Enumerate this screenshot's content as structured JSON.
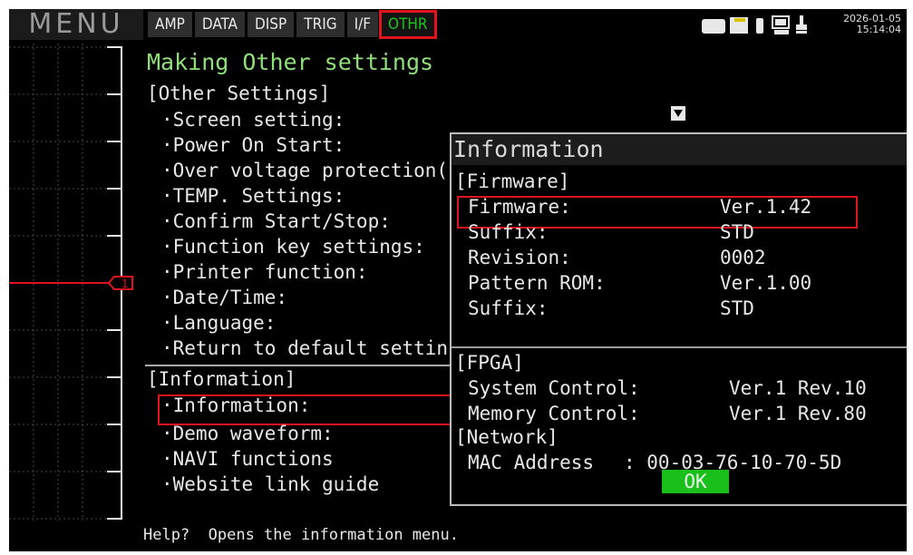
{
  "header": {
    "menu_label": "MENU",
    "tabs": [
      {
        "label": "AMP"
      },
      {
        "label": "DATA"
      },
      {
        "label": "DISP"
      },
      {
        "label": "TRIG"
      },
      {
        "label": "I/F"
      },
      {
        "label": "OTHR",
        "active": true
      }
    ],
    "date": "2026-01-05",
    "time": "15:14:04",
    "status_icons": [
      "memory-card-icon",
      "sd-card-icon",
      "usb-stick-icon",
      "network-pc-icon",
      "plug-icon"
    ]
  },
  "waveform": {
    "channel_marker": "1",
    "trace_color": "#e0141e"
  },
  "menu": {
    "title": "Making Other settings",
    "other_section": "[Other Settings]",
    "other_items": [
      "·Screen setting:",
      "·Power On Start:",
      "·Over voltage protection(",
      "·TEMP. Settings:",
      "·Confirm Start/Stop:",
      "·Function key settings:",
      "·Printer function:",
      "·Date/Time:",
      "·Language:",
      "·Return to default settin"
    ],
    "info_section": "[Information]",
    "info_items": [
      "·Information:",
      "·Demo waveform:",
      "·NAVI functions",
      "·Website link guide"
    ]
  },
  "dialog": {
    "title": "Information",
    "firmware_section": "[Firmware]",
    "firmware_rows": [
      {
        "label": "Firmware:",
        "value": "Ver.1.42"
      },
      {
        "label": "Suffix:",
        "value": "STD"
      },
      {
        "label": "Revision:",
        "value": "0002"
      },
      {
        "label": "Pattern ROM:",
        "value": "Ver.1.00"
      },
      {
        "label": "Suffix:",
        "value": "STD"
      }
    ],
    "fpga_section": "[FPGA]",
    "fpga_rows": [
      {
        "label": "System Control:",
        "value": "Ver.1 Rev.10"
      },
      {
        "label": "Memory Control:",
        "value": "Ver.1 Rev.80"
      }
    ],
    "network_section": "[Network]",
    "mac_label": "MAC Address",
    "mac_value": ": 00-03-76-10-70-5D",
    "ok_label": "OK"
  },
  "help": {
    "text": "Help?  Opens the information menu."
  },
  "colors": {
    "accent_red": "#e0141e",
    "active_green": "#21c321",
    "title_green": "#90e07a",
    "ok_green": "#1bbf1b"
  }
}
